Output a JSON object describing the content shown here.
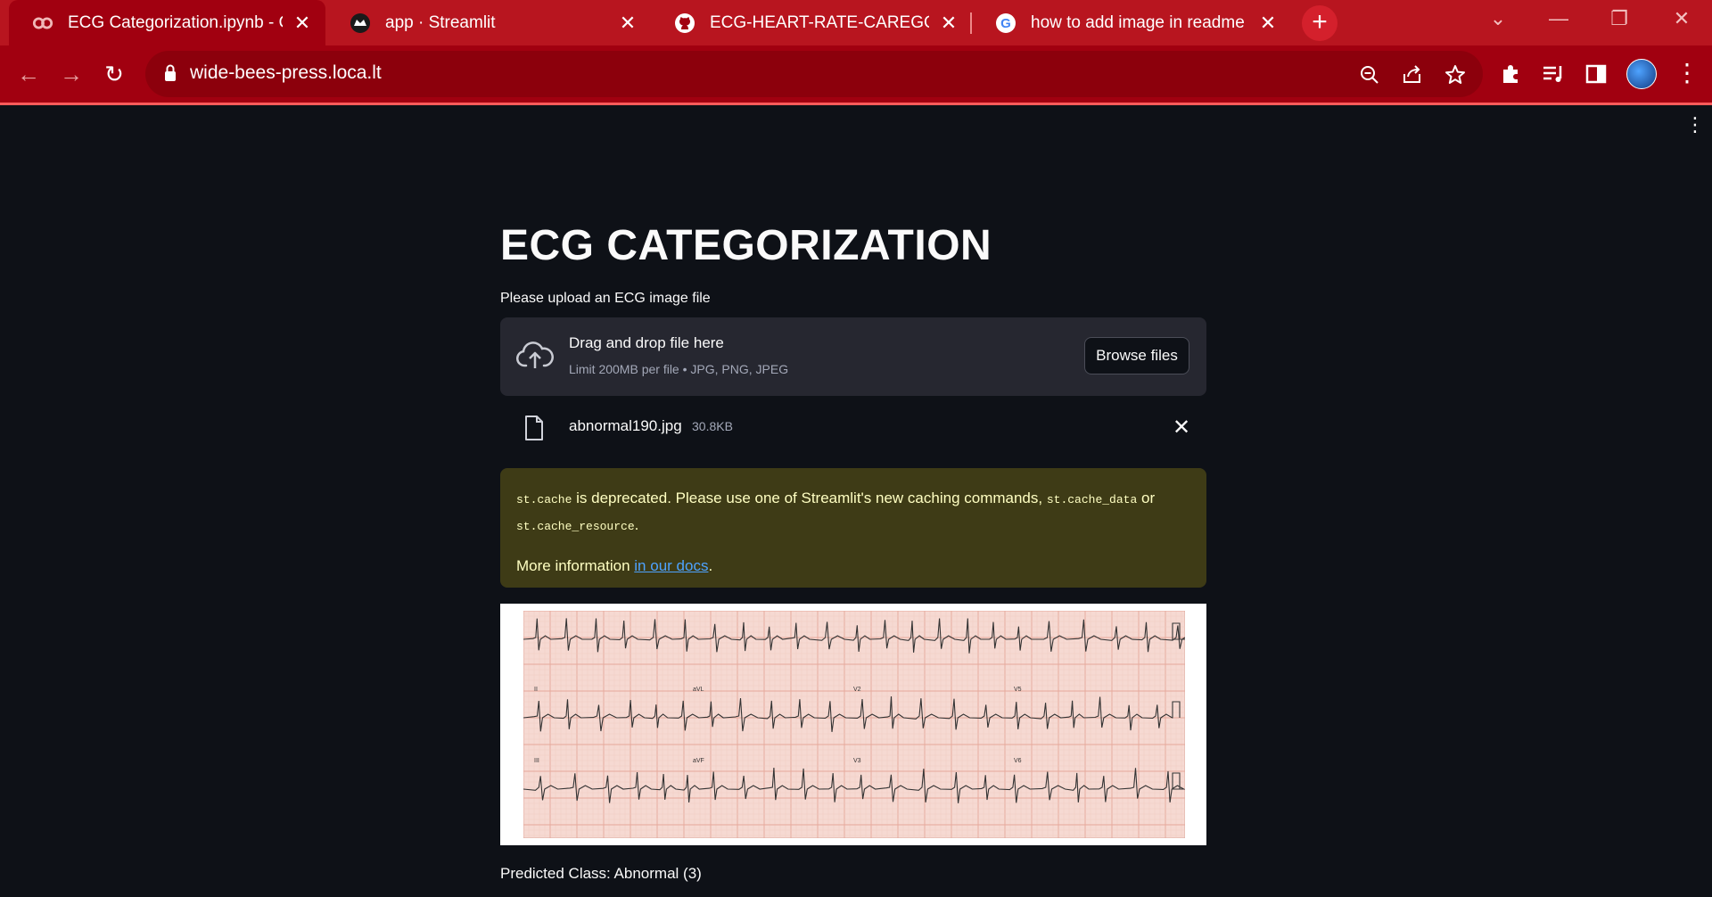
{
  "browser": {
    "tabs": [
      {
        "title": "ECG Categorization.ipynb - Colab",
        "icon": "colab-icon"
      },
      {
        "title": "app · Streamlit",
        "icon": "streamlit-icon"
      },
      {
        "title": "ECG-HEART-RATE-CAREGORIZAT",
        "icon": "github-icon"
      },
      {
        "title": "how to add image in readme file",
        "icon": "google-icon"
      }
    ],
    "active_tab": 0,
    "address": "wide-bees-press.loca.lt",
    "colors": {
      "frame": "#b8151f",
      "toolbar": "#a10010",
      "omnibox": "#8c000c"
    }
  },
  "page": {
    "title": "ECG CATEGORIZATION",
    "uploader": {
      "label": "Please upload an ECG image file",
      "drop_text": "Drag and drop file here",
      "limit_text": "Limit 200MB per file • JPG, PNG, JPEG",
      "browse_label": "Browse files"
    },
    "file": {
      "name": "abnormal190.jpg",
      "size": "30.8KB"
    },
    "warning": {
      "code1": "st.cache",
      "text1": " is deprecated. Please use one of Streamlit's new caching commands, ",
      "code2": "st.cache_data",
      "text2": " or ",
      "code3": "st.cache_resource",
      "text3": ".",
      "more_prefix": "More information ",
      "link_text": "in our docs",
      "more_suffix": "."
    },
    "ecg_leads": [
      "II",
      "aVL",
      "V2",
      "V5",
      "III",
      "aVF",
      "V3",
      "V6"
    ],
    "prediction": "Predicted Class: Abnormal (3)",
    "colors": {
      "background": "#0e1117",
      "panel": "#262730",
      "warning_bg": "#3e3b16",
      "warning_text": "#ffffc2",
      "link": "#4ea3ff"
    }
  }
}
